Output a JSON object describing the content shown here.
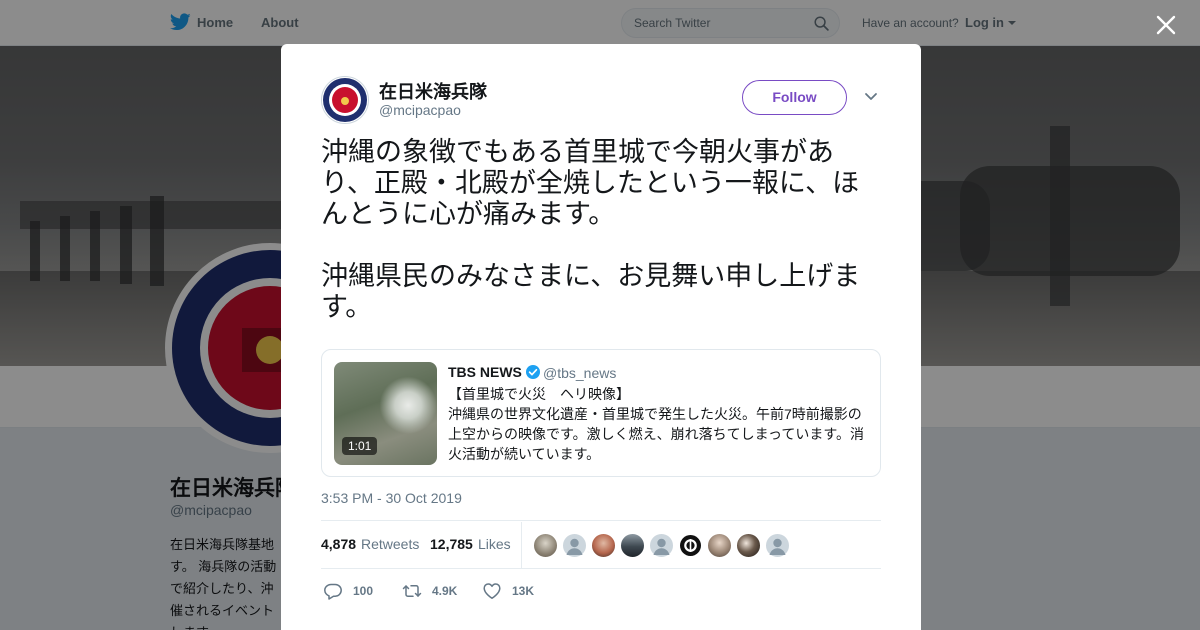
{
  "nav": {
    "home": "Home",
    "about": "About",
    "search_placeholder": "Search Twitter",
    "have_account": "Have an account?",
    "login": "Log in"
  },
  "profile": {
    "name": "在日米海兵隊",
    "handle": "@mcipacpao",
    "bio": "在日米海兵隊基地 す。 海兵隊の活動 で紹介したり、沖 催されるイベント します。"
  },
  "tweet": {
    "display_name": "在日米海兵隊",
    "handle": "@mcipacpao",
    "follow_label": "Follow",
    "text": "沖縄の象徴でもある首里城で今朝火事があり、正殿・北殿が全焼したという一報に、ほんとうに心が痛みます。\n\n沖縄県民のみなさまに、お見舞い申し上げます。",
    "timestamp": "3:53 PM - 30 Oct 2019",
    "retweets_count": "4,878",
    "retweets_label": "Retweets",
    "likes_count": "12,785",
    "likes_label": "Likes",
    "actions": {
      "replies": "100",
      "retweets": "4.9K",
      "likes": "13K"
    }
  },
  "quoted": {
    "name": "TBS NEWS",
    "handle": "@tbs_news",
    "duration": "1:01",
    "text": "【首里城で火災　ヘリ映像】\n沖縄県の世界文化遺産・首里城で発生した火災。午前7時前撮影の上空からの映像です。激しく燃え、崩れ落ちてしまっています。消火活動が続いています。"
  },
  "colors": {
    "accent": "#794bc4",
    "twitter_blue": "#1da1f2",
    "text_secondary": "#657786"
  }
}
